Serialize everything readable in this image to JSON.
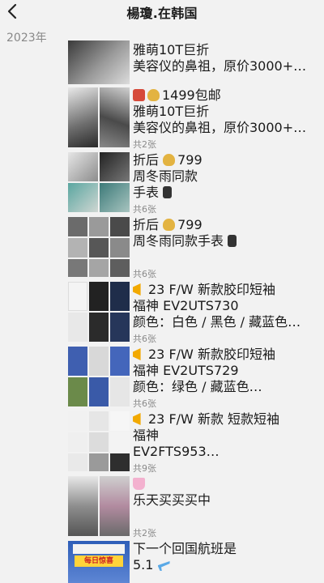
{
  "nav": {
    "title": "楊瓊.在韩国"
  },
  "year": "2023年",
  "posts": [
    {
      "lines": [
        "雅萌10T巨折",
        "美容仪的鼻祖，原价3000+…"
      ],
      "count": ""
    },
    {
      "lines": [
        "1499包邮",
        "雅萌10T巨折",
        "美容仪的鼻祖，原价3000+…"
      ],
      "count": "共2张"
    },
    {
      "lines": [
        "折后",
        "799",
        "周冬雨同款",
        "手表"
      ],
      "count": "共6张"
    },
    {
      "lines": [
        "折后",
        "799",
        "周冬雨同款手表"
      ],
      "count": "共6张"
    },
    {
      "lines": [
        "23 F/W 新款胶印短袖",
        "福神 EV2UTS730",
        "颜色：白色 / 黑色 / 藏蓝色…"
      ],
      "count": "共6张"
    },
    {
      "lines": [
        "23 F/W 新款胶印短袖",
        "福神 EV2UTS729",
        "颜色：绿色 / 藏蓝色…"
      ],
      "count": "共6张"
    },
    {
      "lines": [
        "23 F/W 新款 短款短袖",
        "福神",
        "EV2FTS953…"
      ],
      "count": "共9张"
    },
    {
      "lines": [
        "乐天买买买中"
      ],
      "count": "共2张"
    },
    {
      "lines": [
        "下一个回国航班是",
        "5.1"
      ],
      "count": ""
    }
  ],
  "banner_text": "每日惊喜",
  "icons": {
    "back": "chevron-left-icon",
    "red_sale": "red-square-emoji-icon",
    "money_bag": "money-bag-emoji-icon",
    "watch": "watch-emoji-icon",
    "megaphone": "megaphone-emoji-icon",
    "shopping_bags": "shopping-bags-emoji-icon",
    "airplane": "airplane-emoji-icon"
  },
  "colors": {
    "background": "#f2f2f2",
    "count_text": "#8a8a8a"
  }
}
